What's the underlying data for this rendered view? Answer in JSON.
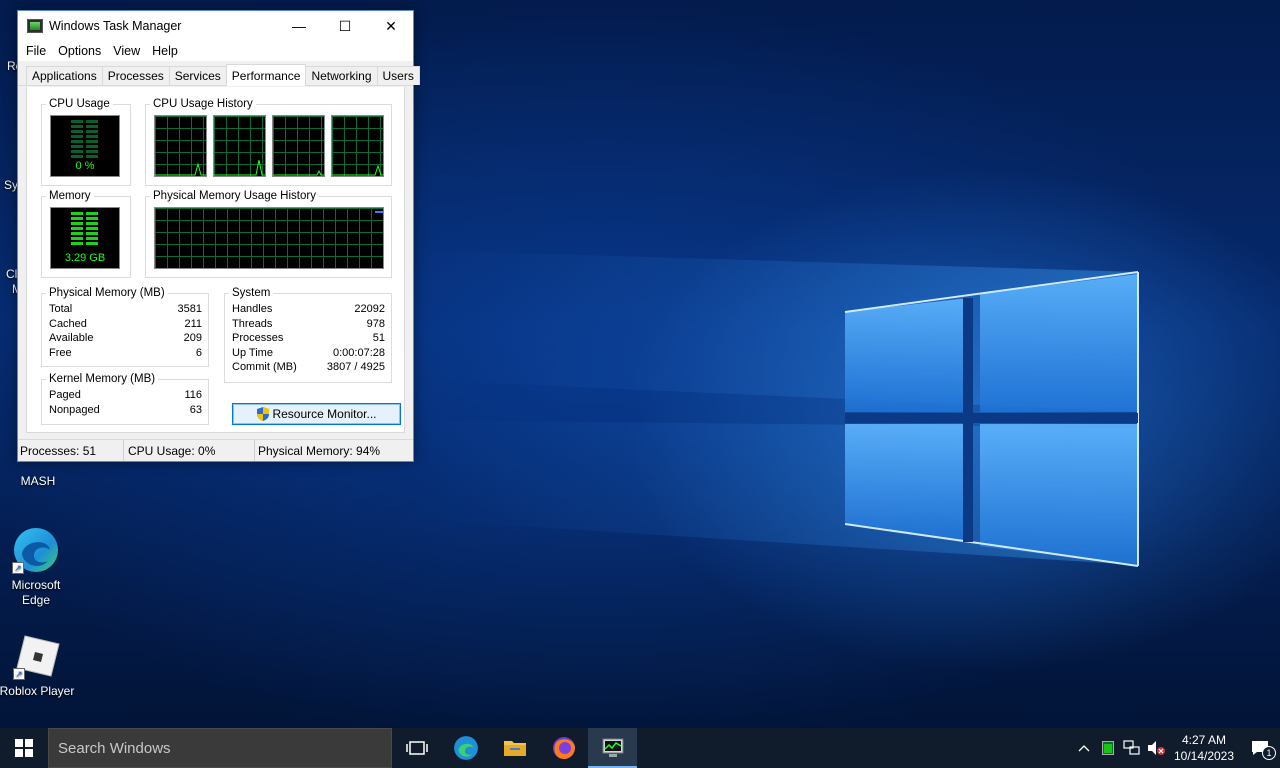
{
  "window": {
    "title": "Windows Task Manager",
    "minimize": "—",
    "maximize": "☐",
    "close": "✕"
  },
  "menu": [
    "File",
    "Options",
    "View",
    "Help"
  ],
  "tabs": [
    "Applications",
    "Processes",
    "Services",
    "Performance",
    "Networking",
    "Users"
  ],
  "active_tab": "Performance",
  "performance": {
    "cpu_usage_label": "CPU Usage",
    "cpu_usage_value": "0 %",
    "cpu_history_label": "CPU Usage History",
    "memory_label": "Memory",
    "memory_value": "3.29 GB",
    "memory_history_label": "Physical Memory Usage History"
  },
  "physical_memory": {
    "label": "Physical Memory (MB)",
    "rows": [
      {
        "name": "Total",
        "value": "3581"
      },
      {
        "name": "Cached",
        "value": "211"
      },
      {
        "name": "Available",
        "value": "209"
      },
      {
        "name": "Free",
        "value": "6"
      }
    ]
  },
  "kernel_memory": {
    "label": "Kernel Memory (MB)",
    "rows": [
      {
        "name": "Paged",
        "value": "116"
      },
      {
        "name": "Nonpaged",
        "value": "63"
      }
    ]
  },
  "system": {
    "label": "System",
    "rows": [
      {
        "name": "Handles",
        "value": "22092"
      },
      {
        "name": "Threads",
        "value": "978"
      },
      {
        "name": "Processes",
        "value": "51"
      },
      {
        "name": "Up Time",
        "value": "0:00:07:28"
      },
      {
        "name": "Commit (MB)",
        "value": "3807 / 4925"
      }
    ]
  },
  "resource_monitor_button": "Resource Monitor...",
  "statusbar": {
    "processes": "Processes: 51",
    "cpu": "CPU Usage: 0%",
    "memory": "Physical Memory: 94%"
  },
  "desktop_icons": [
    {
      "label": "MASH"
    },
    {
      "label": "Microsoft Edge"
    },
    {
      "label": "Roblox Player"
    }
  ],
  "desktop_peek": [
    "Re",
    "Sy",
    "Cl",
    "M"
  ],
  "taskbar": {
    "search_placeholder": "Search Windows",
    "time": "4:27 AM",
    "date": "10/14/2023",
    "notification_count": "1"
  },
  "colors": {
    "accent": "#0078d7",
    "graph_green": "#1dff1d",
    "grid_green": "#0a6b38"
  }
}
